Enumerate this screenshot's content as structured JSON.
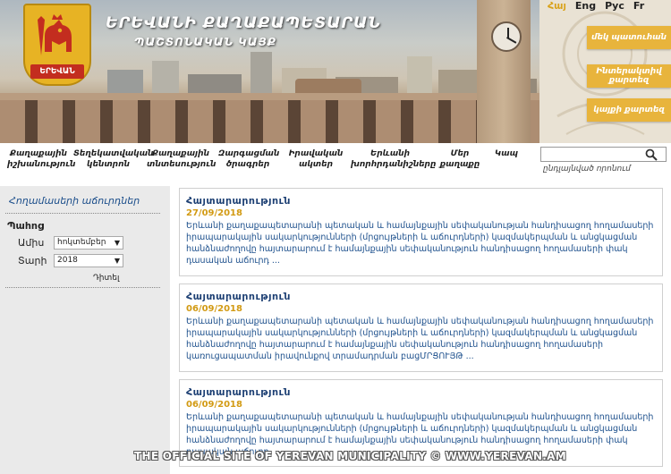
{
  "header": {
    "logo_text": "ԵՐԵՎԱՆ",
    "title": "ԵՐԵՎԱՆԻ ՔԱՂԱՔԱՊԵՏԱՐԱՆ",
    "subtitle": "ՊԱՇՏՈՆԱԿԱՆ ԿԱՅՔ",
    "languages": [
      "Հայ",
      "Eng",
      "Рус",
      "Fr"
    ],
    "side_buttons": [
      "մեկ պատուհան",
      "Ինտերակտիվ քարտեզ",
      "կայքի քարտեզ"
    ]
  },
  "nav": {
    "items": [
      "Քաղաքային իշխանություն",
      "Տեղեկատվական կենտրոն",
      "Քաղաքային տնտեսություն",
      "Զարգացման ծրագրեր",
      "Իրավական ակտեր",
      "Երևանի խորհրդանիշները",
      "Մեր քաղաքը",
      "Կապ"
    ],
    "search_placeholder": "",
    "advanced_search": "ընդլայնված որոնում"
  },
  "sidebar": {
    "link": "Հողամասերի աճուրդներ",
    "archive_heading": "Պահոց",
    "month_label": "Ամիս",
    "month_value": "հոկտեմբեր",
    "year_label": "Տարի",
    "year_value": "2018",
    "view_button": "Դիտել"
  },
  "announcements": [
    {
      "title": "Հայտարարություն",
      "date": "27/09/2018",
      "text": "Երևանի քաղաքապետարանի պետական և համայնքային սեփականության հանդիսացող հողամասերի իրապարակային սակարկությունների (մրցույթների և աճուրդների) կազմակերպման և անցկացման հանձնաժողովը հայտարարում է համայնքային սեփականություն հանդիսացող հողամասերի փակ դասական աճուրդ ..."
    },
    {
      "title": "Հայտարարություն",
      "date": "06/09/2018",
      "text": "Երևանի քաղաքապետարանի պետական և համայնքային սեփականության հանդիսացող հողամասերի իրապարակային սակարկությունների (մրցույթների և աճուրդների) կազմակերպման և անցկացման հանձնաժողովը հայտարարում է համայնքային սեփականություն հանդիսացող հողամասերի կառուցապատման իրավունքով տրամադրման բացՄՐՑՈՒՅԹ ..."
    },
    {
      "title": "Հայտարարություն",
      "date": "06/09/2018",
      "text": "Երևանի քաղաքապետարանի պետական և համայնքային սեփականության հանդիսացող հողամասերի իրապարակային սակարկությունների (մրցույթների և աճուրդների) կազմակերպման և անցկացման հանձնաժողովը հայտարարում է համայնքային սեփականություն հանդիսացող հողամասերի փակ դասական աճուրդ"
    }
  ],
  "footer": {
    "watermark": "THE OFFICIAL SITE OF YEREVAN MUNICIPALITY  ©  WWW.YEREVAN.AM"
  },
  "colors": {
    "accent": "#e8b43c",
    "link": "#1c4f8c",
    "date": "#d29a13"
  }
}
